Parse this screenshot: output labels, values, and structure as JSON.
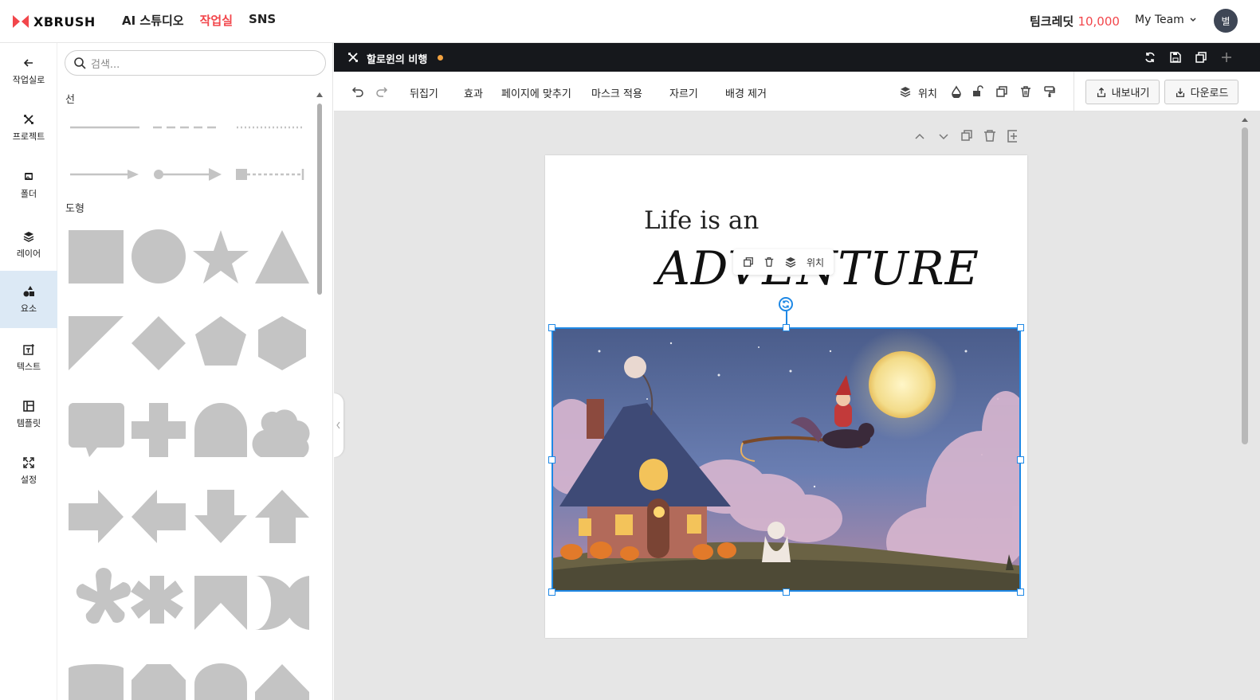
{
  "brand": {
    "name": "XBRUSH",
    "logo_color": "#f2464b"
  },
  "nav": {
    "items": [
      {
        "label": "AI 스튜디오",
        "active": false
      },
      {
        "label": "작업실",
        "active": true
      },
      {
        "label": "SNS",
        "active": false
      }
    ]
  },
  "account": {
    "credit_label": "팀크레딧",
    "credit_value": "10,000",
    "team": "My Team",
    "avatar": "별"
  },
  "rail": {
    "items": [
      {
        "label": "작업실로",
        "icon": "back-arrow-icon"
      },
      {
        "label": "프로젝트",
        "icon": "project-icon"
      },
      {
        "label": "폴더",
        "icon": "folder-icon"
      },
      {
        "label": "레이어",
        "icon": "layers-icon"
      },
      {
        "label": "요소",
        "icon": "elements-icon",
        "active": true
      },
      {
        "label": "텍스트",
        "icon": "text-icon"
      },
      {
        "label": "템플릿",
        "icon": "template-icon"
      },
      {
        "label": "설정",
        "icon": "settings-icon"
      }
    ]
  },
  "panel": {
    "search_placeholder": "검색...",
    "section_lines": "선",
    "section_shapes": "도형",
    "shape_color": "#c4c4c4"
  },
  "document": {
    "title": "할로윈의 비행",
    "unsaved_dot_color": "#f2a240"
  },
  "toolbar": {
    "flip": "뒤집기",
    "effect": "효과",
    "fit_page": "페이지에 맞추기",
    "apply_mask": "마스크 적용",
    "crop": "자르기",
    "remove_bg": "배경 제거",
    "position": "위치",
    "export": "내보내기",
    "download": "다운로드"
  },
  "canvas": {
    "text_top": "Life is an",
    "text_bottom": "ADVENTURE",
    "mini_toolbar_position": "위치",
    "selection_color": "#1e88e5"
  }
}
